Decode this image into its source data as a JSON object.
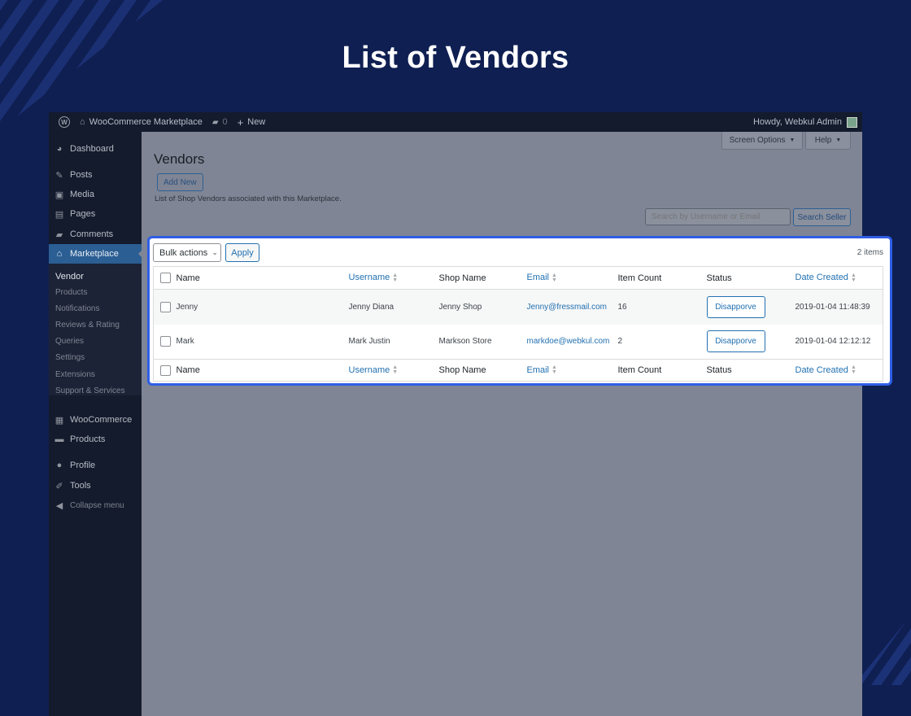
{
  "hero": {
    "title": "List of Vendors"
  },
  "adminbar": {
    "site_name": "WooCommerce Marketplace",
    "comments_count": "0",
    "new_label": "New",
    "greeting": "Howdy, Webkul Admin"
  },
  "sidebar": {
    "items": [
      {
        "label": "Dashboard",
        "icon": "dashboard-icon"
      },
      {
        "label": "Posts",
        "icon": "pin-icon"
      },
      {
        "label": "Media",
        "icon": "media-icon"
      },
      {
        "label": "Pages",
        "icon": "pages-icon"
      },
      {
        "label": "Comments",
        "icon": "comment-icon"
      },
      {
        "label": "Marketplace",
        "icon": "store-icon"
      },
      {
        "label": "WooCommerce",
        "icon": "woo-icon"
      },
      {
        "label": "Products",
        "icon": "archive-icon"
      },
      {
        "label": "Profile",
        "icon": "user-icon"
      },
      {
        "label": "Tools",
        "icon": "wrench-icon"
      },
      {
        "label": "Collapse menu",
        "icon": "collapse-icon"
      }
    ],
    "submenu": [
      "Vendor",
      "Products",
      "Notifications",
      "Reviews & Rating",
      "Queries",
      "Settings",
      "Extensions",
      "Support & Services"
    ]
  },
  "screen": {
    "screen_options": "Screen Options",
    "help": "Help"
  },
  "page": {
    "title": "Vendors",
    "add_new": "Add New",
    "description": "List of Shop Vendors associated with this Marketplace.",
    "search_placeholder": "Search by Username or Email",
    "search_button": "Search Seller"
  },
  "table": {
    "bulk_actions": "Bulk actions",
    "apply": "Apply",
    "items_count": "2 items",
    "columns": [
      "Name",
      "Username",
      "Shop Name",
      "Email",
      "Item Count",
      "Status",
      "Date Created"
    ],
    "rows": [
      {
        "name": "Jenny",
        "username": "Jenny Diana",
        "shop": "Jenny Shop",
        "email": "Jenny@fressmail.com",
        "count": "16",
        "status": "Disapporve",
        "date": "2019-01-04 11:48:39"
      },
      {
        "name": "Mark",
        "username": "Mark Justin",
        "shop": "Markson Store",
        "email": "markdoe@webkul.com",
        "count": "2",
        "status": "Disapporve",
        "date": "2019-01-04 12:12:12"
      }
    ]
  },
  "colors": {
    "background": "#0f1f52",
    "highlight": "#2f5ee6",
    "link": "#2271b1",
    "menu_active": "#2b5e93"
  }
}
